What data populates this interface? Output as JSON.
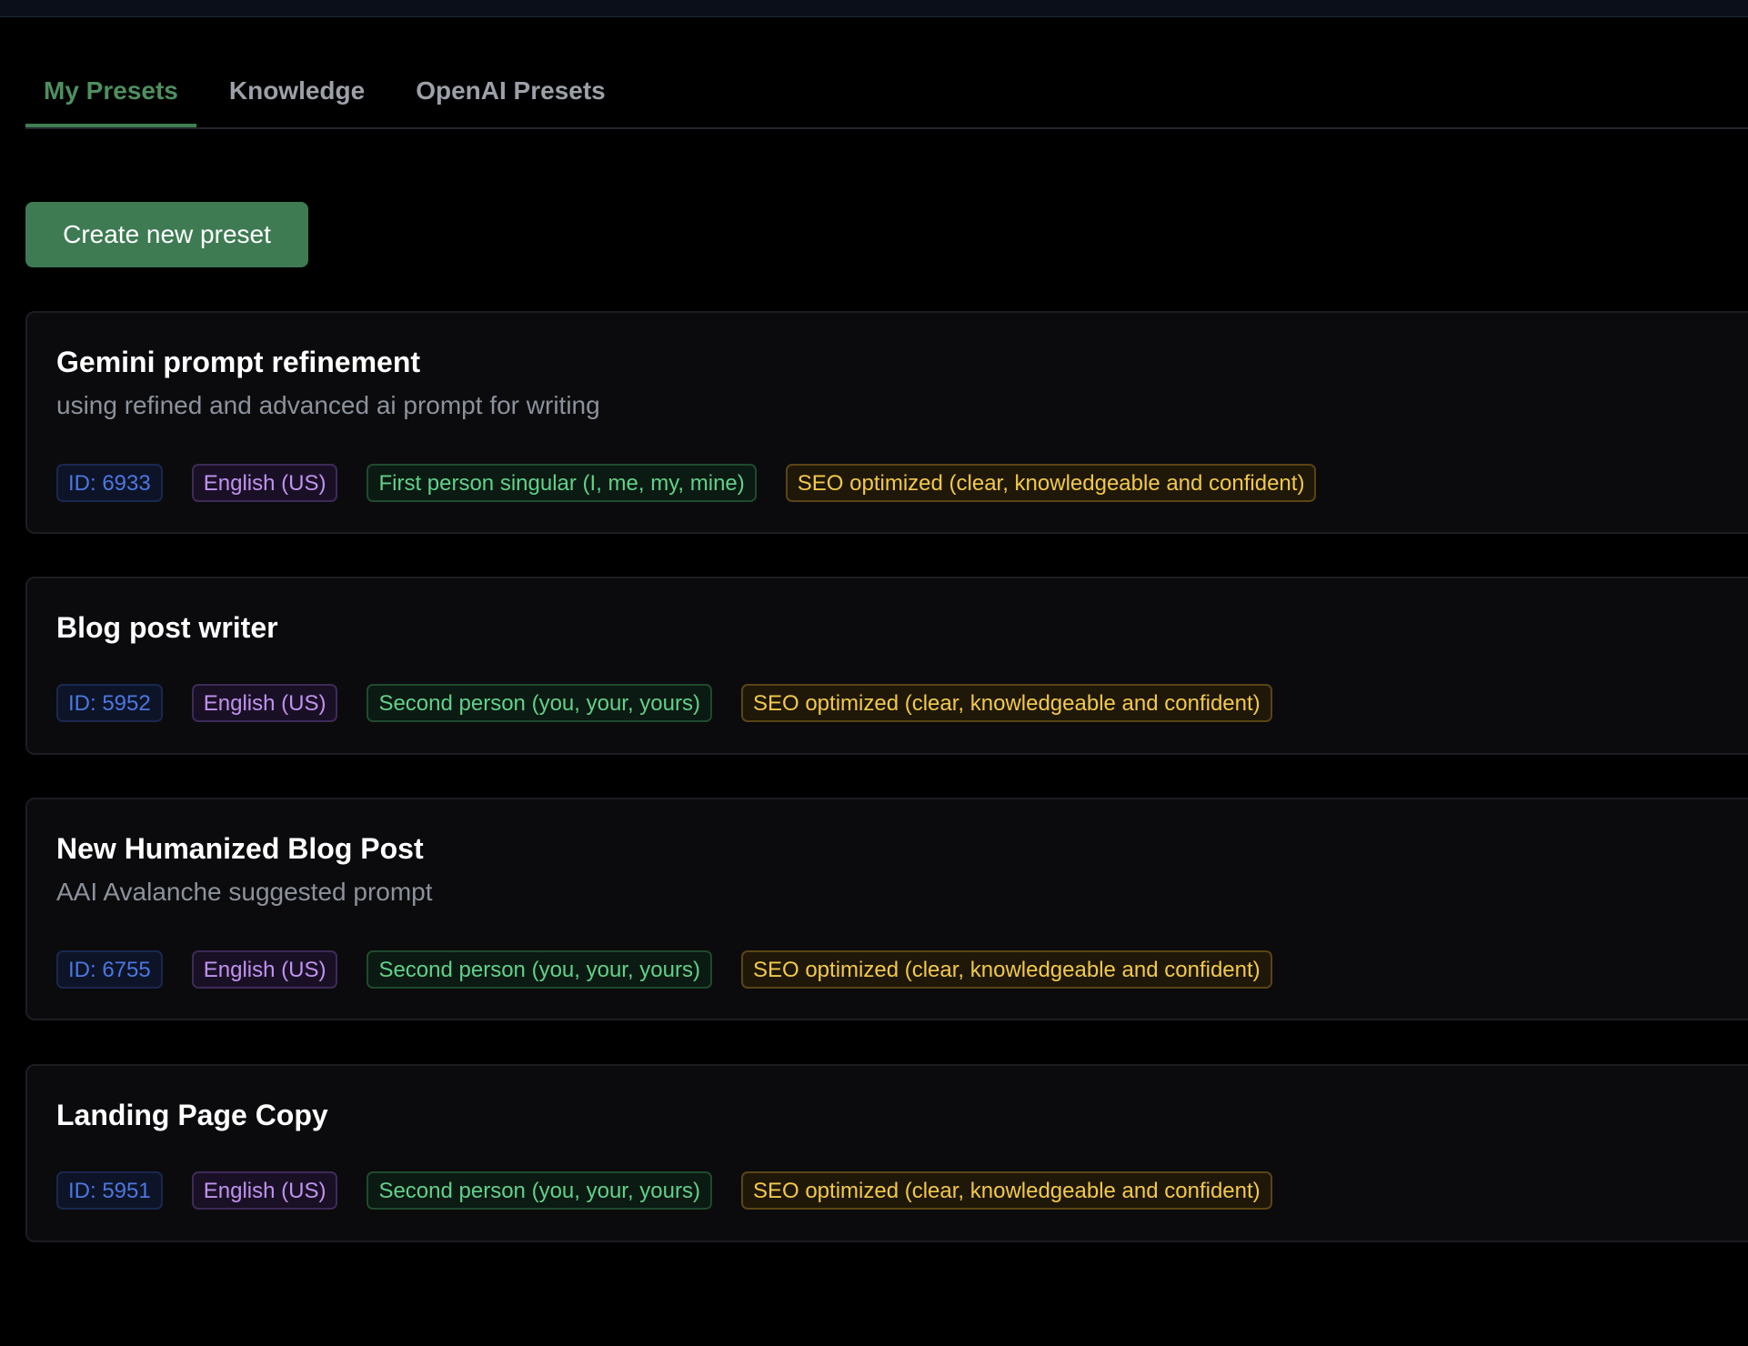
{
  "tabs": [
    {
      "label": "My Presets",
      "active": true
    },
    {
      "label": "Knowledge",
      "active": false
    },
    {
      "label": "OpenAI Presets",
      "active": false
    }
  ],
  "create_button": {
    "label": "Create new preset"
  },
  "presets": [
    {
      "title": "Gemini prompt refinement",
      "description": "using refined and advanced ai prompt for writing",
      "id": "ID: 6933",
      "language": "English (US)",
      "person": "First person singular (I, me, my, mine)",
      "tone": "SEO optimized (clear, knowledgeable and confident)"
    },
    {
      "title": "Blog post writer",
      "description": "",
      "id": "ID: 5952",
      "language": "English (US)",
      "person": "Second person (you, your, yours)",
      "tone": "SEO optimized (clear, knowledgeable and confident)"
    },
    {
      "title": "New Humanized Blog Post",
      "description": "AAI Avalanche suggested prompt",
      "id": "ID: 6755",
      "language": "English (US)",
      "person": "Second person (you, your, yours)",
      "tone": "SEO optimized (clear, knowledgeable and confident)"
    },
    {
      "title": "Landing Page Copy",
      "description": "",
      "id": "ID: 5951",
      "language": "English (US)",
      "person": "Second person (you, your, yours)",
      "tone": "SEO optimized (clear, knowledgeable and confident)"
    }
  ],
  "colors": {
    "accent": "#3e7b53",
    "active_tab": "#4e8f5f",
    "badge_id": "#4c77e0",
    "badge_language": "#c093ee",
    "badge_person": "#62d08a",
    "badge_tone": "#f2c94c"
  }
}
